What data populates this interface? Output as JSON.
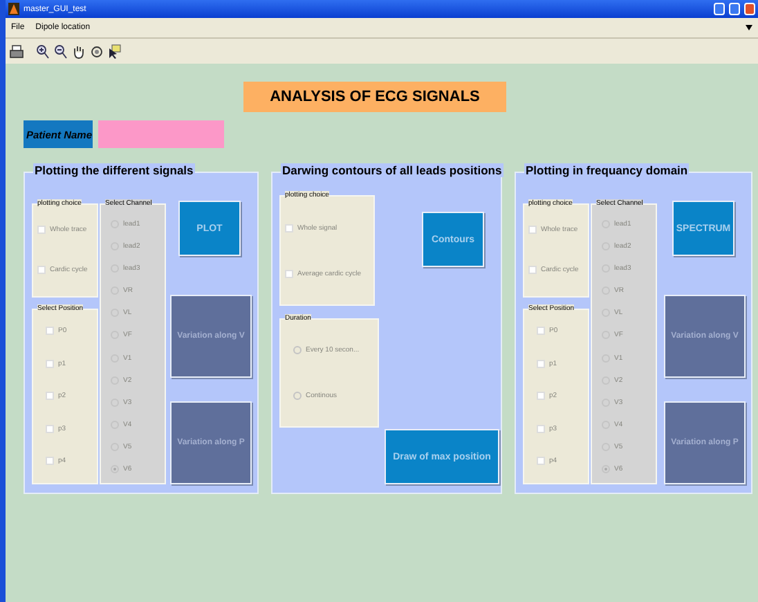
{
  "window": {
    "title": "master_GUI_test"
  },
  "menu": [
    "File",
    "Dipole location"
  ],
  "heading": "ANALYSIS OF ECG SIGNALS",
  "patient": {
    "label": "Patient Name"
  },
  "panels": [
    {
      "kind": "signals",
      "title": "Plotting the different signals",
      "left_groups": [
        {
          "kind": "choice",
          "title": "plotting choice",
          "disabled": true,
          "items": [
            {
              "kind": "checkbox",
              "label": "Whole trace",
              "checked": false
            },
            {
              "kind": "checkbox",
              "label": "Cardic cycle",
              "checked": false
            }
          ]
        },
        {
          "kind": "position",
          "title": "Select Position",
          "disabled": true,
          "items": [
            {
              "kind": "checkbox",
              "label": "P0",
              "checked": false
            },
            {
              "kind": "checkbox",
              "label": "p1",
              "checked": false
            },
            {
              "kind": "checkbox",
              "label": "p2",
              "checked": false
            },
            {
              "kind": "checkbox",
              "label": "p3",
              "checked": false
            },
            {
              "kind": "checkbox",
              "label": "p4",
              "checked": false
            }
          ]
        }
      ],
      "channel_group": {
        "title": "Select Channel",
        "disabled": true,
        "items": [
          {
            "label": "lead1",
            "selected": false
          },
          {
            "label": "lead2",
            "selected": false
          },
          {
            "label": "lead3",
            "selected": false
          },
          {
            "label": "VR",
            "selected": false
          },
          {
            "label": "VL",
            "selected": false
          },
          {
            "label": "VF",
            "selected": false
          },
          {
            "label": "V1",
            "selected": false
          },
          {
            "label": "V2",
            "selected": false
          },
          {
            "label": "V3",
            "selected": false
          },
          {
            "label": "V4",
            "selected": false
          },
          {
            "label": "V5",
            "selected": false
          },
          {
            "label": "V6",
            "selected": true
          }
        ]
      },
      "buttons": [
        {
          "kind": "primary",
          "label": "PLOT"
        },
        {
          "kind": "secondary",
          "label": "Variation along V"
        },
        {
          "kind": "secondary",
          "label": "Variation along P"
        }
      ]
    },
    {
      "kind": "contours",
      "title": "Darwing contours of all leads positions",
      "left_groups": [
        {
          "kind": "choice",
          "title": "plotting choice",
          "disabled": true,
          "items": [
            {
              "kind": "checkbox",
              "label": "Whole signal",
              "checked": false
            },
            {
              "kind": "checkbox",
              "label": "Average cardic cycle",
              "checked": false
            }
          ]
        },
        {
          "kind": "duration",
          "title": "Duration",
          "disabled": true,
          "items": [
            {
              "kind": "radio",
              "label": "Every 10 secon...",
              "selected": false
            },
            {
              "kind": "radio",
              "label": "Continous",
              "selected": false
            }
          ]
        }
      ],
      "buttons": [
        {
          "kind": "primary",
          "label": "Contours"
        },
        {
          "kind": "primary",
          "label": "Draw of max position"
        }
      ]
    },
    {
      "kind": "signals",
      "title": "Plotting in frequancy domain",
      "left_groups": [
        {
          "kind": "choice",
          "title": "plotting choice",
          "disabled": true,
          "items": [
            {
              "kind": "checkbox",
              "label": "Whole trace",
              "checked": false
            },
            {
              "kind": "checkbox",
              "label": "Cardic cycle",
              "checked": false
            }
          ]
        },
        {
          "kind": "position",
          "title": "Select Position",
          "disabled": true,
          "items": [
            {
              "kind": "checkbox",
              "label": "P0",
              "checked": false
            },
            {
              "kind": "checkbox",
              "label": "p1",
              "checked": false
            },
            {
              "kind": "checkbox",
              "label": "p2",
              "checked": false
            },
            {
              "kind": "checkbox",
              "label": "p3",
              "checked": false
            },
            {
              "kind": "checkbox",
              "label": "p4",
              "checked": false
            }
          ]
        }
      ],
      "channel_group": {
        "title": "Select Channel",
        "disabled": true,
        "items": [
          {
            "label": "lead1",
            "selected": false
          },
          {
            "label": "lead2",
            "selected": false
          },
          {
            "label": "lead3",
            "selected": false
          },
          {
            "label": "VR",
            "selected": false
          },
          {
            "label": "VL",
            "selected": false
          },
          {
            "label": "VF",
            "selected": false
          },
          {
            "label": "V1",
            "selected": false
          },
          {
            "label": "V2",
            "selected": false
          },
          {
            "label": "V3",
            "selected": false
          },
          {
            "label": "V4",
            "selected": false
          },
          {
            "label": "V5",
            "selected": false
          },
          {
            "label": "V6",
            "selected": true
          }
        ]
      },
      "buttons": [
        {
          "kind": "primary",
          "label": "SPECTRUM"
        },
        {
          "kind": "secondary",
          "label": "Variation along V"
        },
        {
          "kind": "secondary",
          "label": "Variation along P"
        }
      ]
    }
  ]
}
